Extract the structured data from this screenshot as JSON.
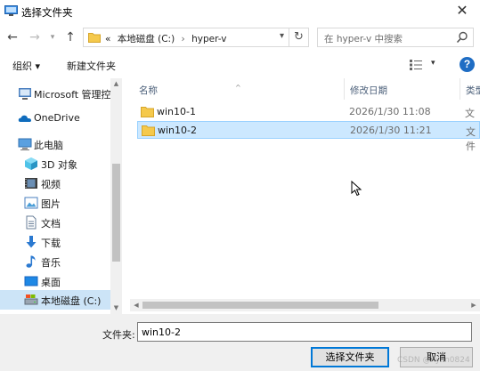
{
  "window": {
    "title": "选择文件夹",
    "close_glyph": "✕"
  },
  "nav": {
    "back_glyph": "←",
    "forward_glyph": "→",
    "recent_glyph": "▾",
    "up_glyph": "↑",
    "breadcrumb": {
      "overflow": "«",
      "items": [
        "本地磁盘 (C:)",
        "hyper-v"
      ],
      "separator": "›"
    },
    "refresh_glyph": "↻",
    "search_placeholder": "在 hyper-v 中搜索"
  },
  "toolbar": {
    "organize": "组织 ▾",
    "new_folder": "新建文件夹",
    "view_drop": "▾",
    "help": "?"
  },
  "sidebar": {
    "items": [
      {
        "label": "Microsoft 管理控",
        "icon": "management-console-icon"
      },
      {
        "label": "OneDrive",
        "icon": "onedrive-cloud-icon"
      },
      {
        "label": "此电脑",
        "icon": "this-pc-icon"
      },
      {
        "label": "3D 对象",
        "icon": "3d-objects-icon"
      },
      {
        "label": "视频",
        "icon": "video-icon"
      },
      {
        "label": "图片",
        "icon": "pictures-icon"
      },
      {
        "label": "文档",
        "icon": "documents-icon"
      },
      {
        "label": "下载",
        "icon": "downloads-icon"
      },
      {
        "label": "音乐",
        "icon": "music-icon"
      },
      {
        "label": "桌面",
        "icon": "desktop-icon"
      },
      {
        "label": "本地磁盘 (C:)",
        "icon": "local-disk-icon",
        "selected": true
      }
    ]
  },
  "filelist": {
    "columns": {
      "name": "名称",
      "date": "修改日期",
      "type": "类型"
    },
    "sort_caret": "^",
    "rows": [
      {
        "name": "win10-1",
        "date": "2026/1/30 11:08",
        "type": "文件",
        "selected": false
      },
      {
        "name": "win10-2",
        "date": "2026/1/30 11:21",
        "type": "文件",
        "selected": true
      }
    ]
  },
  "footer": {
    "folder_label": "文件夹:",
    "folder_value": "win10-2",
    "ok_label": "选择文件夹",
    "cancel_label": "取消",
    "watermark": "CSDN @Kylin0824"
  },
  "colors": {
    "accent": "#0078d7",
    "selection": "#cce8ff",
    "folder": "#f5c94c"
  }
}
